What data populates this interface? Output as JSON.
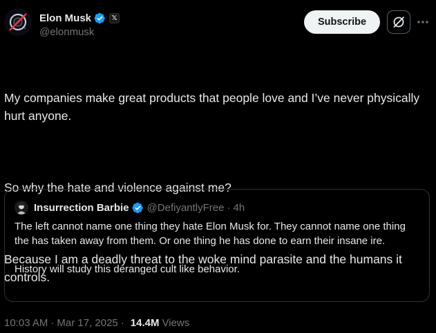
{
  "author": {
    "display_name": "Elon Musk",
    "handle": "@elonmusk",
    "verified": true
  },
  "header_actions": {
    "subscribe_label": "Subscribe",
    "grok_icon": "grok-icon",
    "more_icon": "more-icon"
  },
  "tweet": {
    "paragraphs": [
      "My companies make great products that people love and I’ve never physically hurt anyone.",
      "So why the hate and violence against me?",
      "Because I am a deadly threat to the woke mind parasite and the humans it controls."
    ]
  },
  "quoted_tweet": {
    "display_name": "Insurrection Barbie",
    "handle": "@DefiyantlyFree",
    "separator": "·",
    "time": "4h",
    "paragraphs": [
      "The left cannot name one thing they hate Elon Musk for. They cannot name one thing the has taken away from them. Or one thing he has done to earn their insane ire.",
      "History will study this deranged cult like behavior."
    ]
  },
  "meta": {
    "time": "10:03 AM",
    "separator": "·",
    "date": "Mar 17, 2025",
    "views_count": "14.4M",
    "views_label": "Views"
  },
  "colors": {
    "background": "#000000",
    "text": "#e7e9ea",
    "secondary": "#71767b",
    "verified": "#1d9bf0",
    "border": "#2f3336"
  }
}
